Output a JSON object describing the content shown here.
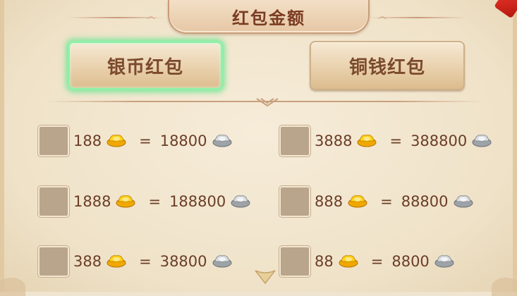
{
  "header": {
    "title": "红包金额"
  },
  "tabs": [
    {
      "label": "银币红包",
      "active": true
    },
    {
      "label": "铜钱红包",
      "active": false
    }
  ],
  "options": [
    {
      "gold": "188",
      "equals": "=",
      "silver": "18800",
      "checked": false
    },
    {
      "gold": "3888",
      "equals": "=",
      "silver": "388800",
      "checked": false
    },
    {
      "gold": "1888",
      "equals": "=",
      "silver": "188800",
      "checked": false
    },
    {
      "gold": "888",
      "equals": "=",
      "silver": "88800",
      "checked": false
    },
    {
      "gold": "388",
      "equals": "=",
      "silver": "38800",
      "checked": false
    },
    {
      "gold": "88",
      "equals": "=",
      "silver": "8800",
      "checked": false
    }
  ],
  "icons": {
    "gold": "gold-ingot-icon",
    "silver": "silver-ingot-icon",
    "scroll": "scroll-down-arrow-icon",
    "close": "red-ribbon-close-icon"
  },
  "colors": {
    "active_glow": "#7fe59b",
    "text": "#6b3d26",
    "title": "#7a3b22"
  }
}
